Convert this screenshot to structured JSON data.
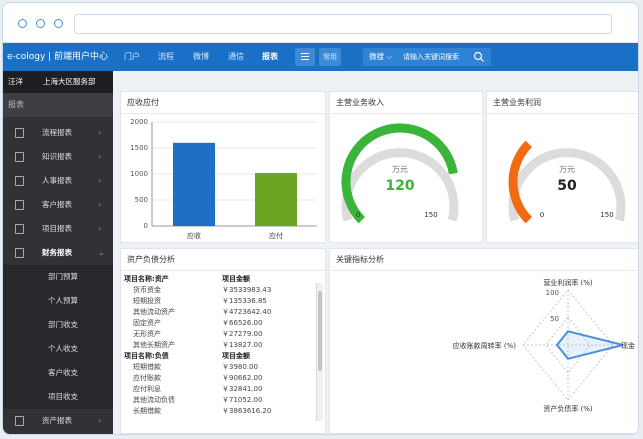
{
  "brand": "e-cology | 前端用户中心",
  "nav": [
    "门户",
    "流程",
    "微博",
    "通信",
    "报表"
  ],
  "common_label": "常用",
  "search": {
    "scope": "微搜",
    "placeholder": "请输入关键词搜索"
  },
  "sidebar": {
    "user": "汪洋",
    "department": "上海大区服务部",
    "section_label": "报表",
    "items": [
      {
        "label": "流程报表"
      },
      {
        "label": "知识报表"
      },
      {
        "label": "人事报表"
      },
      {
        "label": "客户报表"
      },
      {
        "label": "项目报表"
      },
      {
        "label": "财务报表"
      }
    ],
    "sub_items": [
      "部门预算",
      "个人预算",
      "部门收支",
      "个人收支",
      "客户收支",
      "项目收支"
    ],
    "last_item": {
      "label": "资产报表"
    }
  },
  "receivable": {
    "title": "应收应付",
    "y_ticks": [
      "2000",
      "1500",
      "1000",
      "500",
      "0"
    ],
    "categories": [
      "应收",
      "应付"
    ],
    "values": [
      1600,
      1020
    ],
    "ylim": [
      0,
      2000
    ],
    "colors": [
      "#1f6fc5",
      "#6aa621"
    ]
  },
  "income": {
    "title": "主营业务收入",
    "unit": "万元",
    "value": "120",
    "min_label": "0",
    "max_label": "150",
    "color": "#3bb43a"
  },
  "profit": {
    "title": "主营业务利润",
    "unit": "万元",
    "value": "50",
    "min_label": "0",
    "max_label": "150",
    "color": "#f26b13"
  },
  "balance": {
    "title": "资产负债分析",
    "rows": [
      {
        "type": "hdr",
        "c1": "项目名称:资产",
        "c2": "项目金额"
      },
      {
        "type": "item",
        "c1": "货币资金",
        "c2": "￥3533983.43"
      },
      {
        "type": "item",
        "c1": "短期投资",
        "c2": "￥135336.85"
      },
      {
        "type": "item",
        "c1": "其他流动资产",
        "c2": "￥4723642.40"
      },
      {
        "type": "item",
        "c1": "固定资产",
        "c2": "￥66526.00"
      },
      {
        "type": "item",
        "c1": "无形资产",
        "c2": "￥27279.00"
      },
      {
        "type": "item",
        "c1": "其他长期资产",
        "c2": "￥13827.00"
      },
      {
        "type": "hdr",
        "c1": "项目名称:负债",
        "c2": "项目金额"
      },
      {
        "type": "item",
        "c1": "短期借款",
        "c2": "￥3980.00"
      },
      {
        "type": "item",
        "c1": "应付账款",
        "c2": "￥90662.00"
      },
      {
        "type": "item",
        "c1": "应付利息",
        "c2": "￥32841.00"
      },
      {
        "type": "item",
        "c1": "其他流动负债",
        "c2": "￥71052.00"
      },
      {
        "type": "item",
        "c1": "长期借款",
        "c2": "￥3863616.20"
      }
    ]
  },
  "indicators": {
    "title": "关键指标分析",
    "axis_labels": {
      "top": "营业利润率 (%)",
      "right": "现金",
      "bottom": "资产负债率 (%)",
      "left": "应收账款周转率 (%)"
    },
    "ticks": [
      "100",
      "50"
    ],
    "chart_data": {
      "type": "radar",
      "axes": [
        "营业利润率 (%)",
        "",
        "资产负债率 (%)",
        "应收账款周转率 (%)"
      ],
      "series": [
        {
          "values": [
            25,
            100,
            25,
            20
          ]
        }
      ],
      "rmax": 100,
      "color": "#4a8fdd"
    }
  }
}
